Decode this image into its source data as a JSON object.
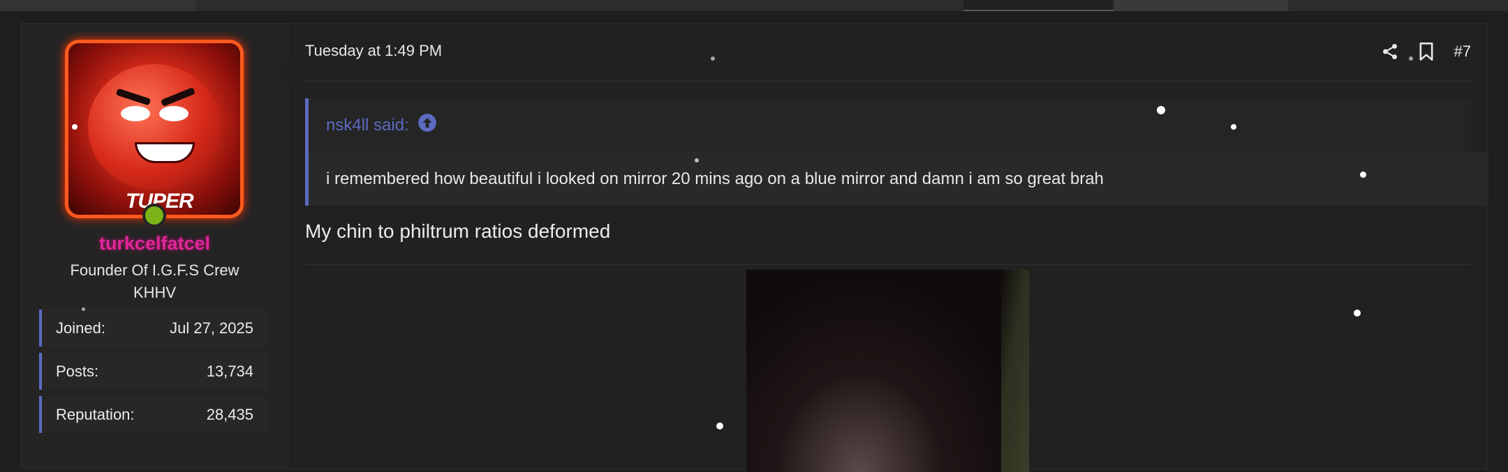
{
  "post": {
    "date": "Tuesday at 1:49 PM",
    "number": "#7",
    "actions": [
      {
        "name": "share-icon"
      },
      {
        "name": "bookmark-icon"
      }
    ]
  },
  "user": {
    "username": "turkcelfatcel",
    "title": "Founder Of I.G.F.S Crew KHHV",
    "avatar_text": "TUPER",
    "stats": [
      {
        "label": "Joined:",
        "value": "Jul 27, 2025"
      },
      {
        "label": "Posts:",
        "value": "13,734"
      },
      {
        "label": "Reputation:",
        "value": "28,435"
      }
    ]
  },
  "quote": {
    "author_line": "nsk4ll said:",
    "body": "i remembered how beautiful i looked on mirror 20 mins ago on a blue mirror and damn i am so great brah"
  },
  "message": {
    "text": "My chin to philtrum ratios deformed"
  },
  "colors": {
    "accent": "#5c6bc0",
    "username": "#e0269a",
    "online": "#7ab317",
    "background": "#1e1e1e"
  }
}
